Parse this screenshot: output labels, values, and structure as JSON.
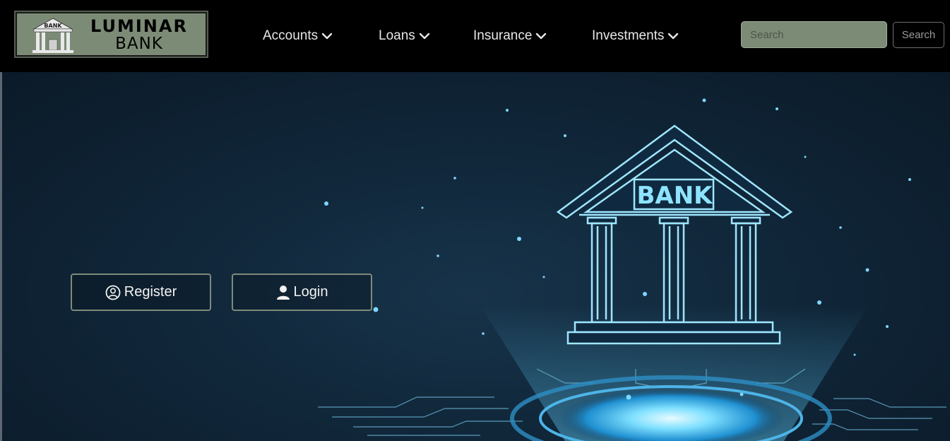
{
  "brand": {
    "logo_text_line1": "LUMINAR",
    "logo_text_line2": "BANK",
    "logo_icon_label": "BANK",
    "logo_icon": "bank-building-icon"
  },
  "nav": {
    "items": [
      {
        "label": "Accounts",
        "icon": "chevron-down-icon"
      },
      {
        "label": "Loans",
        "icon": "chevron-down-icon"
      },
      {
        "label": "Insurance",
        "icon": "chevron-down-icon"
      },
      {
        "label": "Investments",
        "icon": "chevron-down-icon"
      }
    ]
  },
  "search": {
    "placeholder": "Search",
    "value": "",
    "button_label": "Search"
  },
  "hero": {
    "image_label": "BANK",
    "buttons": [
      {
        "label": "Register",
        "icon": "user-circle-icon"
      },
      {
        "label": "Login",
        "icon": "user-icon"
      }
    ]
  },
  "colors": {
    "navbar_bg": "#000000",
    "brand_bg": "#7c8b76",
    "hero_bg": "#0f2436",
    "accent_glow": "#4fc3f7",
    "button_border": "#7e8b7a"
  }
}
